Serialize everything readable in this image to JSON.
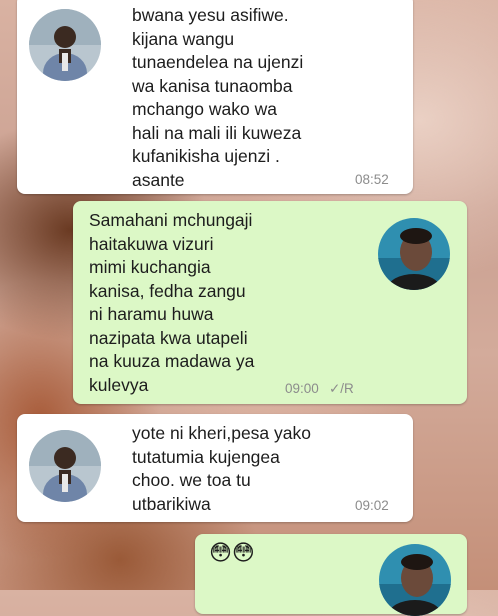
{
  "chat": {
    "messages": [
      {
        "direction": "incoming",
        "text": "bwana yesu asifiwe.\nkijana wangu\ntunaendelea na ujenzi\nwa kanisa tunaomba\nmchango wako wa\nhali na mali ili kuweza\nkufanikisha ujenzi .\nasante",
        "time": "08:52",
        "avatar": "pastor-photo"
      },
      {
        "direction": "outgoing",
        "text": "Samahani mchungaji\nhaitakuwa vizuri\nmimi kuchangia\nkanisa, fedha zangu\nni haramu huwa\nnazipata kwa utapeli\nna kuuza madawa ya\nkulevya",
        "time": "09:00",
        "status": "✓/R",
        "avatar": "young-man-photo"
      },
      {
        "direction": "incoming",
        "text": "yote ni kheri,pesa yako\ntutatumia kujengea\nchoo. we toa tu\nutbarikiwa",
        "time": "09:02",
        "avatar": "pastor-photo"
      },
      {
        "direction": "outgoing",
        "text": "😳😳",
        "avatar": "young-man-photo"
      }
    ]
  },
  "colors": {
    "incoming_bubble": "#ffffff",
    "outgoing_bubble": "#dcf8c6",
    "timestamp": "#8c8c8c"
  }
}
